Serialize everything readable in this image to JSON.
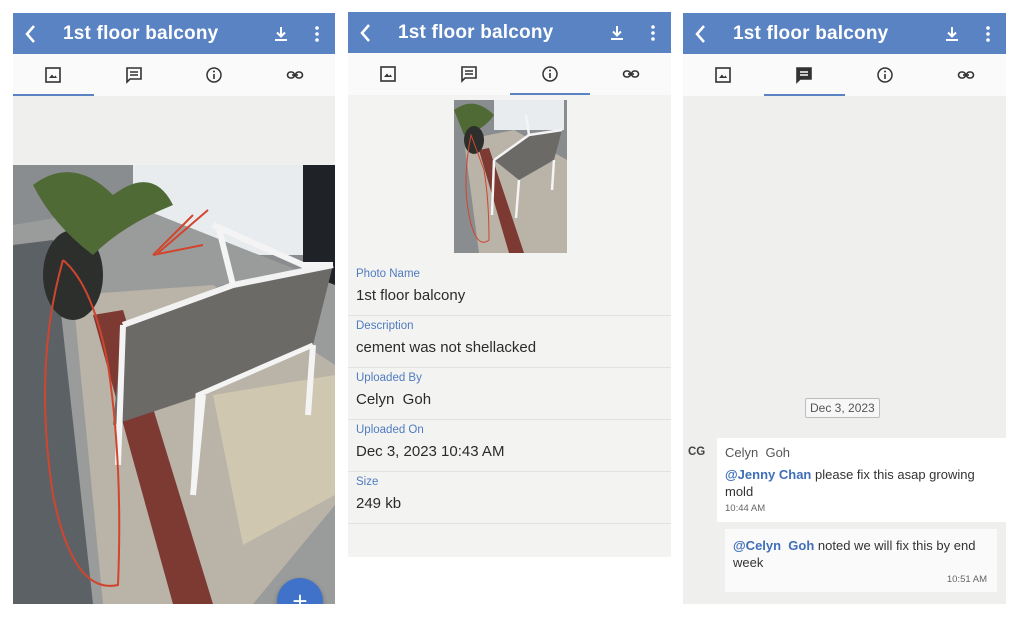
{
  "header": {
    "title": "1st floor balcony"
  },
  "tabs": [
    "photo",
    "comments",
    "info",
    "link"
  ],
  "panel1": {
    "active_tab": 0,
    "fab_label": "+"
  },
  "panel2": {
    "active_tab": 2,
    "fields": [
      {
        "label": "Photo Name",
        "value": "1st floor balcony"
      },
      {
        "label": "Description",
        "value": "cement was not shellacked"
      },
      {
        "label": "Uploaded By",
        "value": "Celyn  Goh"
      },
      {
        "label": "Uploaded On",
        "value": "Dec 3, 2023 10:43 AM"
      },
      {
        "label": "Size",
        "value": "249 kb"
      }
    ]
  },
  "panel3": {
    "active_tab": 1,
    "date_chip": "Dec 3, 2023",
    "avatar_initials": "CG",
    "messages": [
      {
        "sender": "Celyn  Goh",
        "mention": "@Jenny Chan",
        "text": " please fix this asap growing mold",
        "time": "10:44 AM"
      },
      {
        "sender": "",
        "mention": "@Celyn  Goh",
        "text": " noted we will fix this by end week",
        "time": "10:51 AM"
      }
    ]
  },
  "colors": {
    "appbar": "#5a83c3",
    "accent": "#4f7bbf",
    "fab": "#3f72c8"
  }
}
